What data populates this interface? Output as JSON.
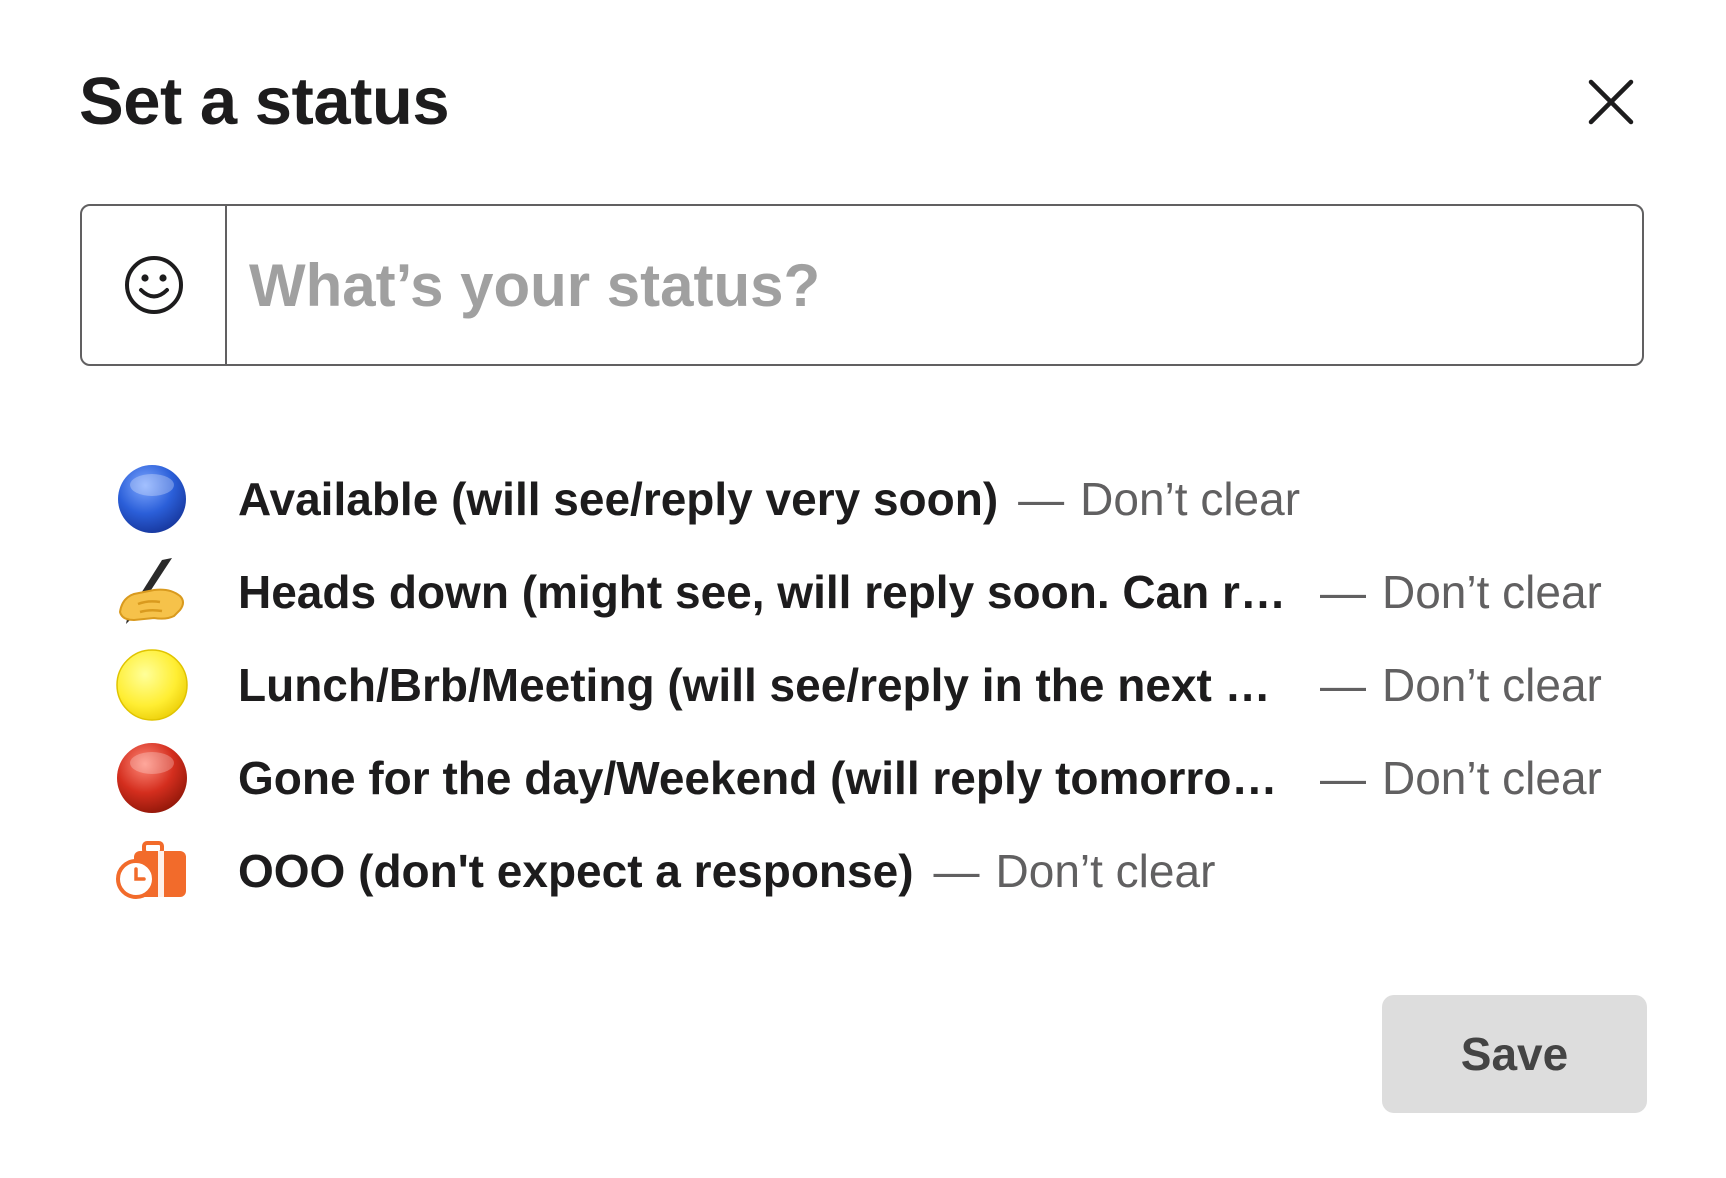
{
  "dialog": {
    "title": "Set a status",
    "close_icon": "close-icon"
  },
  "status_input": {
    "emoji_icon": "smiley-icon",
    "placeholder": "What’s your status?",
    "value": ""
  },
  "presets": [
    {
      "emoji": "blue-circle-icon",
      "text": "Available (will see/reply very soon)",
      "separator": "—",
      "clear": "Don’t clear",
      "color": "#2b5fd9"
    },
    {
      "emoji": "writing-hand-icon",
      "text": "Heads down (might see, will reply soon. Can re…",
      "separator": "—",
      "clear": "Don’t clear"
    },
    {
      "emoji": "yellow-circle-icon",
      "text": "Lunch/Brb/Meeting (will see/reply in the next …",
      "separator": "—",
      "clear": "Don’t clear",
      "color": "#ffee33"
    },
    {
      "emoji": "red-circle-icon",
      "text": "Gone for the day/Weekend (will reply tomorro…",
      "separator": "—",
      "clear": "Don’t clear",
      "color": "#d42e1e"
    },
    {
      "emoji": "out-of-office-icon",
      "text": "OOO (don't expect a response)",
      "separator": "—",
      "clear": "Don’t clear",
      "color": "#f26b2b"
    }
  ],
  "save_button": {
    "label": "Save"
  }
}
